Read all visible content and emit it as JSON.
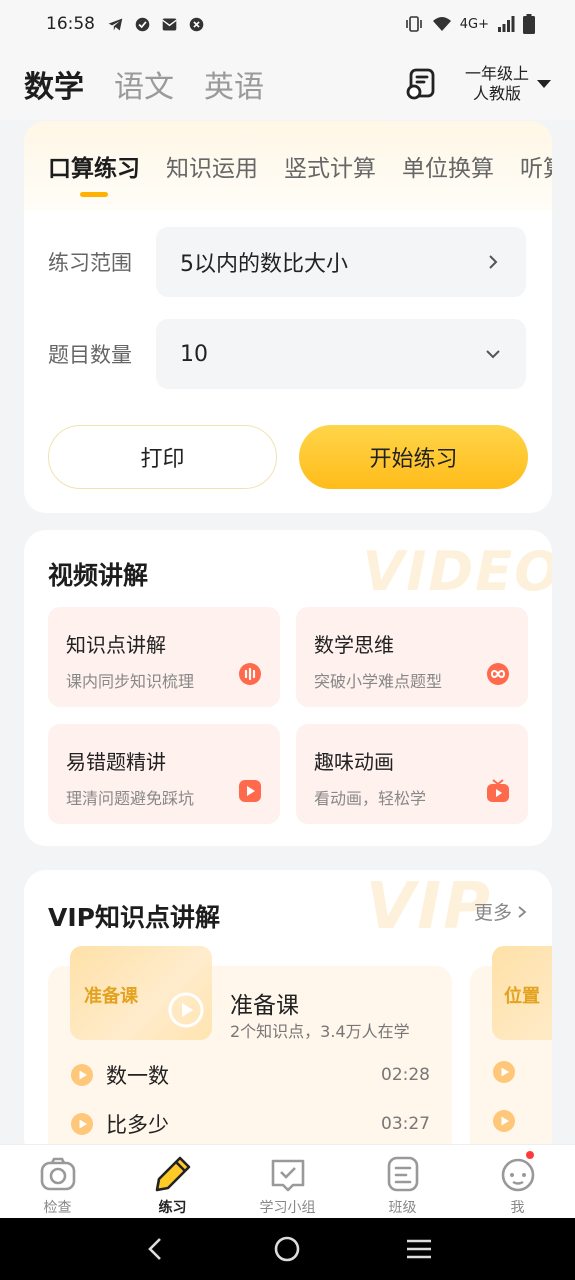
{
  "status_bar": {
    "time": "16:58",
    "network": "4G+"
  },
  "subjects": [
    {
      "label": "数学",
      "active": true
    },
    {
      "label": "语文",
      "active": false
    },
    {
      "label": "英语",
      "active": false
    }
  ],
  "grade": {
    "line1": "一年级上",
    "line2": "人教版"
  },
  "practice": {
    "tabs": [
      "口算练习",
      "知识运用",
      "竖式计算",
      "单位换算",
      "听算"
    ],
    "range_label": "练习范围",
    "range_value": "5以内的数比大小",
    "count_label": "题目数量",
    "count_value": "10",
    "print_label": "打印",
    "start_label": "开始练习"
  },
  "video": {
    "title": "视频讲解",
    "watermark": "VIDEO",
    "tiles": [
      {
        "title": "知识点讲解",
        "sub": "课内同步知识梳理",
        "icon": "audio-bars-icon",
        "color": "#ff6a4d"
      },
      {
        "title": "数学思维",
        "sub": "突破小学难点题型",
        "icon": "infinity-icon",
        "color": "#ff6a4d"
      },
      {
        "title": "易错题精讲",
        "sub": "理清问题避免踩坑",
        "icon": "play-square-icon",
        "color": "#ff6a4d"
      },
      {
        "title": "趣味动画",
        "sub": "看动画，轻松学",
        "icon": "tv-icon",
        "color": "#ff6a4d"
      }
    ]
  },
  "vip": {
    "title": "VIP知识点讲解",
    "watermark": "VIP",
    "more_label": "更多",
    "course": {
      "thumb_label": "准备课",
      "title": "准备课",
      "meta": "2个知识点，3.4万人在学",
      "lessons": [
        {
          "name": "数一数",
          "time": "02:28"
        },
        {
          "name": "比多少",
          "time": "03:27"
        }
      ]
    },
    "course2": {
      "thumb_label": "位置"
    }
  },
  "bottom_nav": [
    {
      "label": "检查",
      "icon": "camera-icon",
      "active": false
    },
    {
      "label": "练习",
      "icon": "pencil-icon",
      "active": true
    },
    {
      "label": "学习小组",
      "icon": "group-check-icon",
      "active": false
    },
    {
      "label": "班级",
      "icon": "class-icon",
      "active": false
    },
    {
      "label": "我",
      "icon": "profile-face-icon",
      "active": false
    }
  ],
  "colors": {
    "accent": "#ffbc1a",
    "tile_bg": "#fff1ee",
    "icon_orange": "#ff6a4d"
  }
}
